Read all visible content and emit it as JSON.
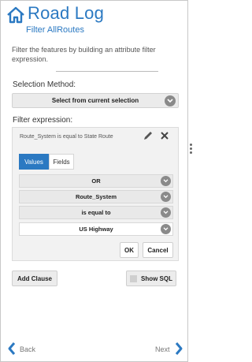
{
  "header": {
    "icon": "home-icon",
    "title": "Road Log",
    "subtitle": "Filter AllRoutes"
  },
  "description": "Filter the features by building an attribute filter expression.",
  "selection": {
    "label": "Selection Method:",
    "value": "Select from current selection"
  },
  "filter": {
    "label": "Filter expression:",
    "expression": "Route_System is equal to State Route",
    "tabs": [
      {
        "label": "Values",
        "active": true
      },
      {
        "label": "Fields",
        "active": false
      }
    ],
    "rows": [
      {
        "value": "OR"
      },
      {
        "value": "Route_System"
      },
      {
        "value": "is equal to"
      },
      {
        "value": "US Highway"
      }
    ],
    "ok_label": "OK",
    "cancel_label": "Cancel"
  },
  "actions": {
    "add_clause_label": "Add Clause",
    "show_sql_label": "Show SQL"
  },
  "footer": {
    "back_label": "Back",
    "next_label": "Next"
  },
  "colors": {
    "accent": "#2b79c2",
    "chevron": "#8a8a8a"
  }
}
